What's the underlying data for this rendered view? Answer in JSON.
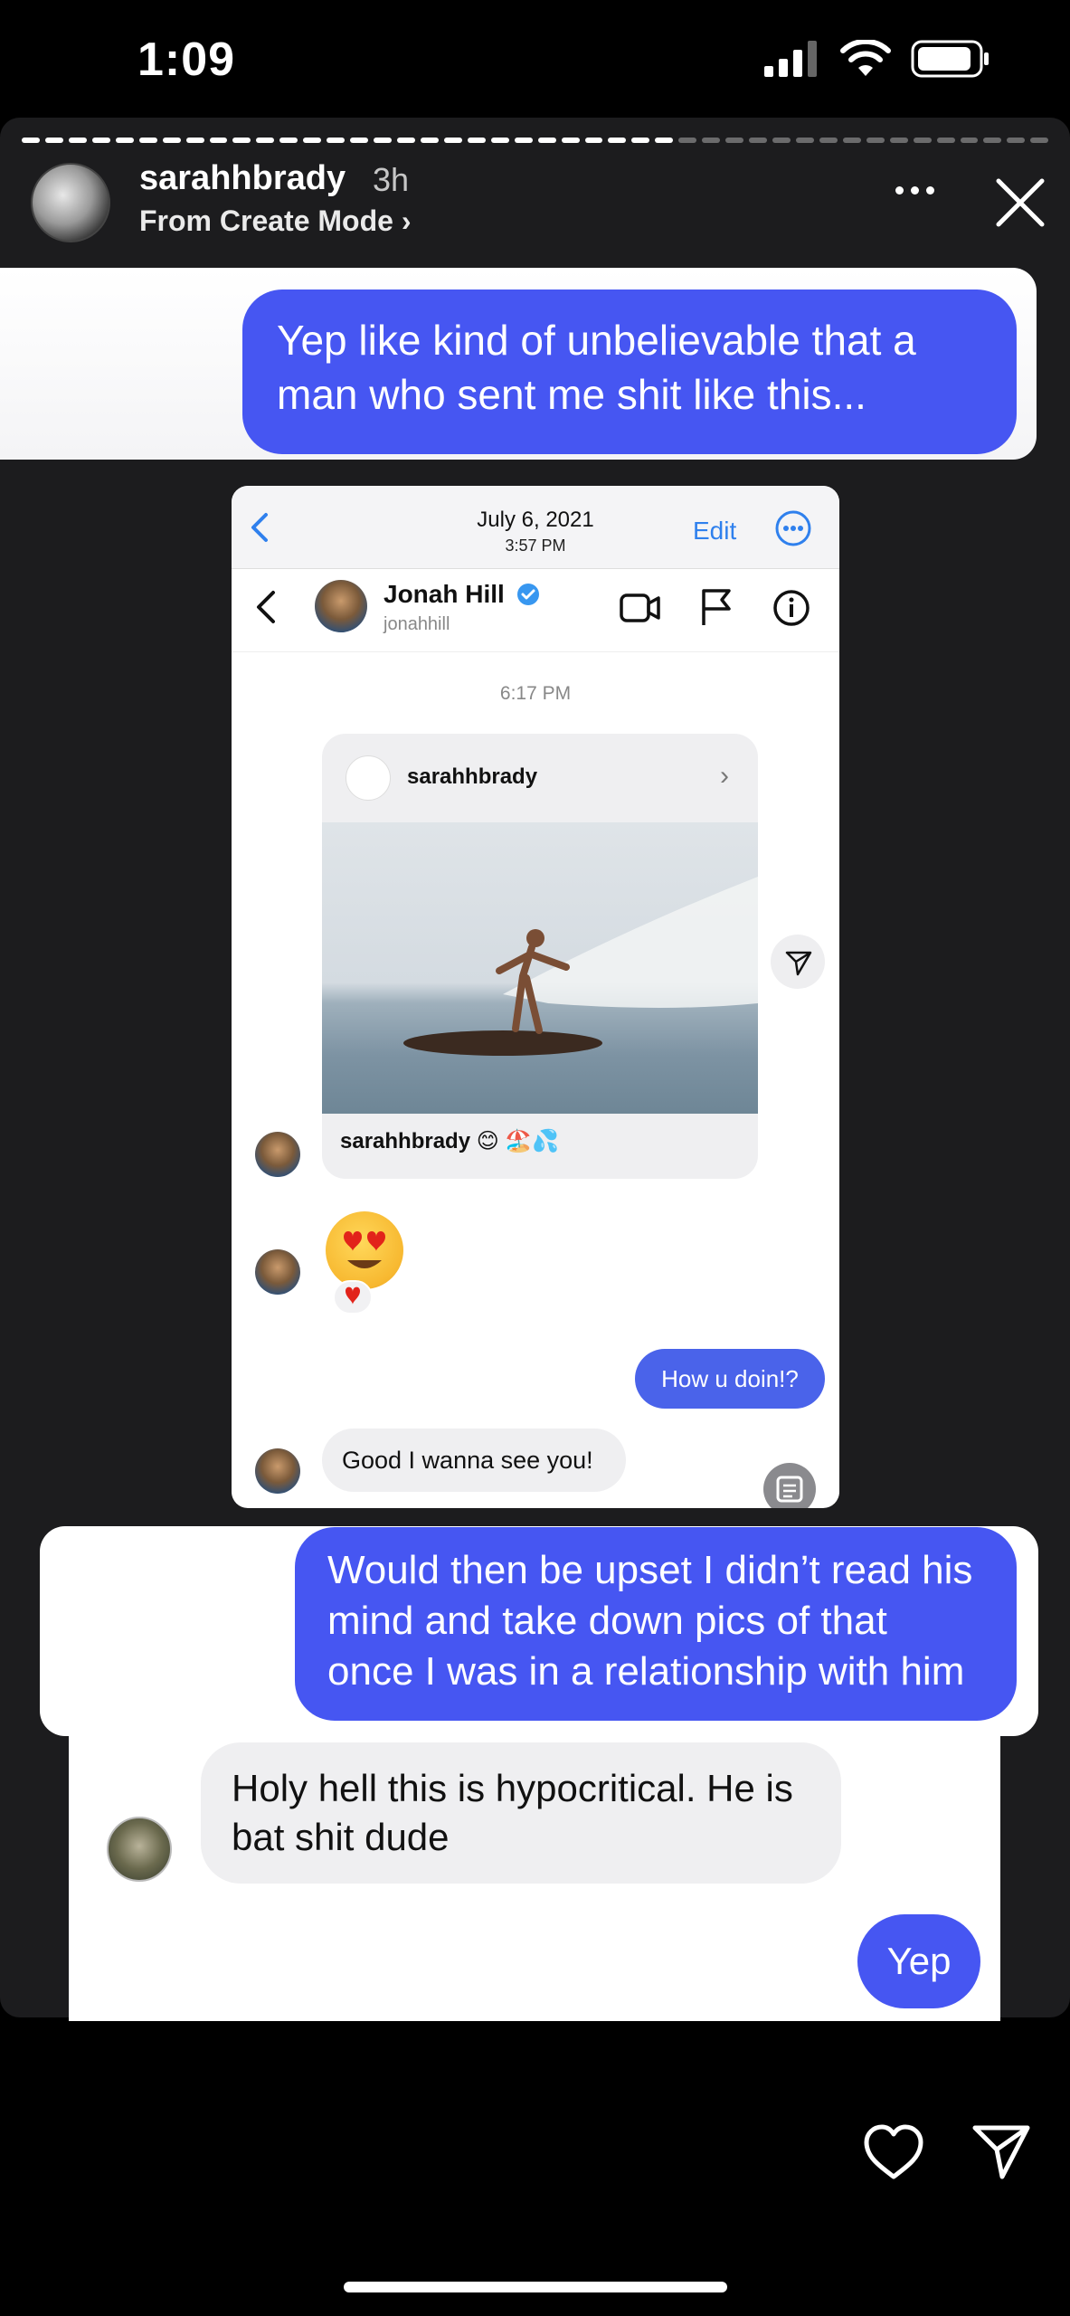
{
  "status_bar": {
    "time": "1:09"
  },
  "story_header": {
    "username": "sarahhbrady",
    "time_ago": "3h",
    "subtitle": "From Create Mode ›"
  },
  "messages_top": {
    "bubble_1": "Yep like kind of unbelievable that a man who sent me shit like this..."
  },
  "screenshot": {
    "date": "July 6, 2021",
    "clock": "3:57 PM",
    "edit_label": "Edit",
    "contact_name": "Jonah Hill",
    "contact_handle": "jonahhill",
    "thread_time": "6:17 PM",
    "post": {
      "username": "sarahhbrady",
      "caption": "sarahhbrady 😊 🏖️💦"
    },
    "heart_eyes_emoji": "😍",
    "reaction_emoji": "❤️",
    "sent_message": "How u doin!?",
    "reply_message": "Good I wanna see you!"
  },
  "messages_bottom": {
    "bubble_2": "Would then be upset I didn’t read his mind and take down pics of that once I was in a relationship with him",
    "gray_bubble": "Holy hell this is hypocritical. He is bat shit dude",
    "yep": "Yep"
  },
  "icons": [
    "signal-icon",
    "wifi-icon",
    "battery-icon",
    "more-icon",
    "close-icon",
    "back-chevron-icon",
    "options-icon",
    "video-call-icon",
    "flag-icon",
    "info-icon",
    "verified-badge-icon",
    "share-icon",
    "scan-icon",
    "heart-icon",
    "send-icon"
  ],
  "colors": {
    "accent_blue": "#4656f2",
    "story_bg": "#1c1c1e",
    "link_blue": "#2f80ed"
  }
}
